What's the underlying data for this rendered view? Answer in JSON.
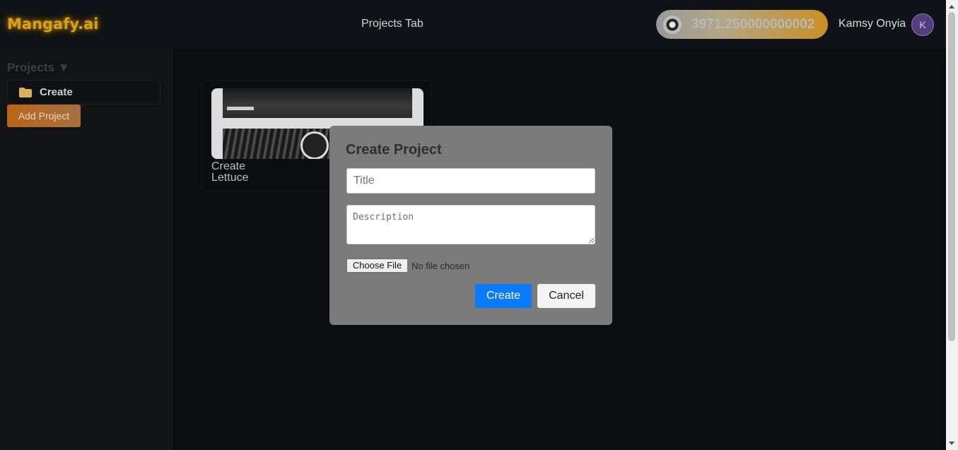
{
  "header": {
    "logo": "Mangafy.ai",
    "center_title": "Projects Tab",
    "credits": "3971.250000000002",
    "user_name": "Kamsy Onyia",
    "avatar_letter": "K"
  },
  "sidebar": {
    "title": "Projects ▼",
    "items": [
      {
        "label": "Create",
        "icon": "folder-icon"
      }
    ],
    "add_button": "Add Project"
  },
  "main": {
    "cards": [
      {
        "title": "Create Lettuce",
        "thumbnail": "manga-pages-image"
      }
    ]
  },
  "modal": {
    "title": "Create Project",
    "title_placeholder": "Title",
    "description_placeholder": "Description",
    "choose_file": "Choose File",
    "file_status": "No file chosen",
    "create_label": "Create",
    "cancel_label": "Cancel"
  },
  "colors": {
    "accent_blue": "#0a7bff",
    "logo_gold": "#d9a216",
    "add_button_orange": "#b8651c",
    "modal_bg": "#7b7b7b"
  }
}
